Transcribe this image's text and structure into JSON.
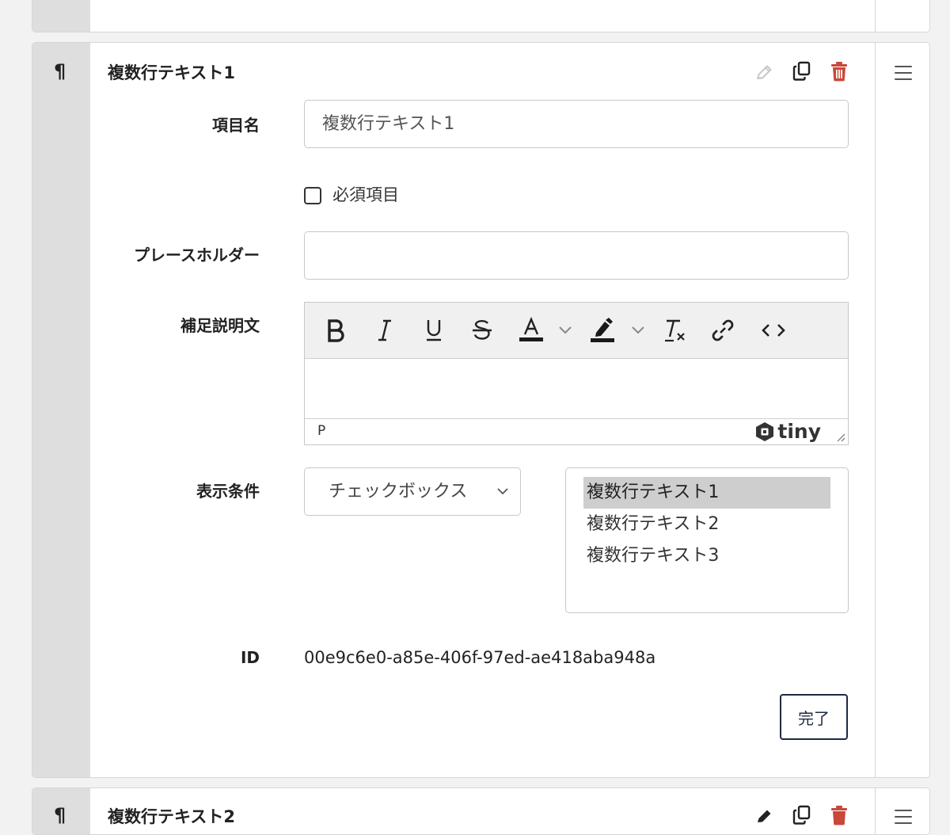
{
  "colors": {
    "gutter": "#dedede",
    "trash": "#c9473b",
    "pencil_disabled": "#c8c8c8",
    "button_border": "#1e2a44",
    "selected_option_bg": "#cecece"
  },
  "cards": [
    {
      "type_icon": "pilcrow-icon",
      "title": "複数行テキスト1"
    },
    {
      "type_icon": "pilcrow-icon",
      "title": "複数行テキスト2"
    }
  ],
  "form": {
    "item_name": {
      "label": "項目名",
      "value": "複数行テキスト1"
    },
    "required": {
      "label": "必須項目",
      "checked": false
    },
    "placeholder": {
      "label": "プレースホルダー",
      "value": ""
    },
    "description": {
      "label": "補足説明文",
      "toolbar": [
        "bold",
        "italic",
        "underline",
        "strikethrough",
        "text-color",
        "highlight-color",
        "clear-formatting",
        "link",
        "source-code"
      ],
      "status_path": "P",
      "brand": "tiny"
    },
    "display_condition": {
      "label": "表示条件",
      "selected": "チェックボックス",
      "options": [
        "複数行テキスト1",
        "複数行テキスト2",
        "複数行テキスト3"
      ],
      "selected_option_index": 0
    },
    "id": {
      "label": "ID",
      "value": "00e9c6e0-a85e-406f-97ed-ae418aba948a"
    },
    "done_label": "完了"
  }
}
